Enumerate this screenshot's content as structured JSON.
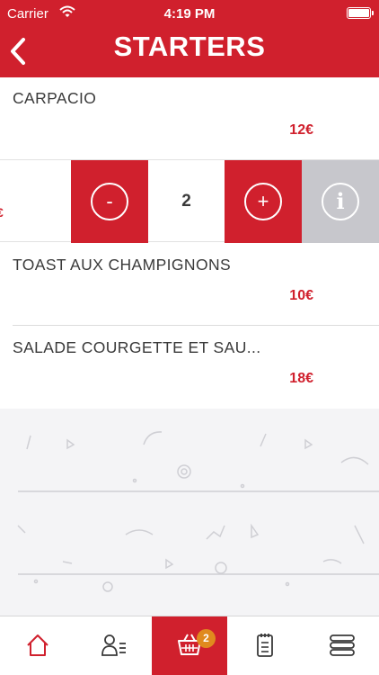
{
  "status_bar": {
    "carrier": "Carrier",
    "time": "4:19 PM"
  },
  "header": {
    "title": "STARTERS"
  },
  "items": [
    {
      "name": "CARPACIO",
      "price": "12€"
    },
    {
      "name": "TOAST AUX CHAMPIGNONS",
      "price": "10€"
    },
    {
      "name": "SALADE COURGETTE ET SAU...",
      "price": "18€"
    }
  ],
  "swipe_row": {
    "partial_price": "€",
    "minus_label": "-",
    "quantity": "2",
    "plus_label": "+",
    "info_label": "i"
  },
  "tab_bar": {
    "tabs": [
      "home-icon",
      "profile-menu-icon",
      "basket-icon",
      "order-list-icon",
      "menu-layers-icon"
    ],
    "active": "basket-icon",
    "basket_badge": "2"
  },
  "colors": {
    "brand": "#d0202d",
    "info_grey": "#c7c7cc",
    "badge": "#e08a1e"
  }
}
